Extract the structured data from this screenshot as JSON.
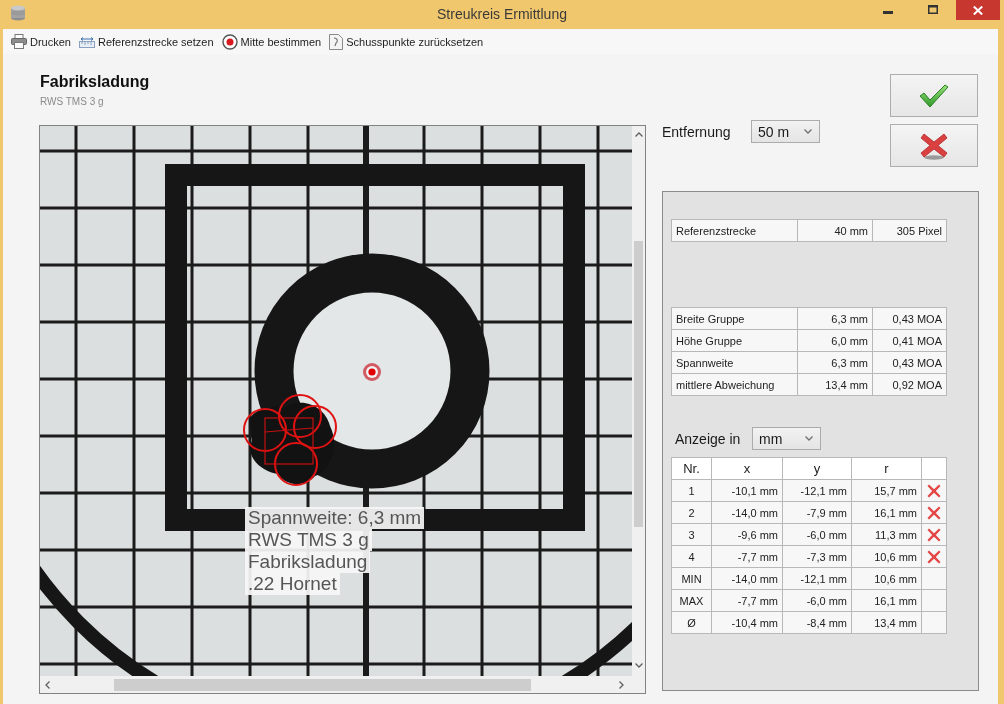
{
  "window": {
    "title": "Streukreis Ermittlung"
  },
  "toolbar": [
    {
      "kind": "print",
      "label": "Drucken"
    },
    {
      "kind": "reference",
      "label": "Referenzstrecke setzen"
    },
    {
      "kind": "center",
      "label": "Mitte bestimmen"
    },
    {
      "kind": "reset",
      "label": "Schusspunkte zurücksetzen"
    }
  ],
  "header": {
    "title": "Fabriksladung",
    "subtitle": "RWS TMS 3 g"
  },
  "target": {
    "caption": [
      "Spannweite: 6,3 mm",
      "RWS TMS 3 g",
      "Fabriksladung",
      ".22 Hornet"
    ]
  },
  "distance": {
    "label": "Entfernung",
    "value": "50 m"
  },
  "reference": {
    "label": "Referenzstrecke",
    "length": "40 mm",
    "pixels": "305 Pixel"
  },
  "group_stats": [
    {
      "label": "Breite Gruppe",
      "mm": "6,3 mm",
      "moa": "0,43 MOA"
    },
    {
      "label": "Höhe Gruppe",
      "mm": "6,0 mm",
      "moa": "0,41 MOA"
    },
    {
      "label": "Spannweite",
      "mm": "6,3 mm",
      "moa": "0,43 MOA"
    },
    {
      "label": "mittlere Abweichung",
      "mm": "13,4 mm",
      "moa": "0,92 MOA"
    }
  ],
  "display_unit": {
    "label": "Anzeige in",
    "value": "mm"
  },
  "shots": {
    "columns": [
      "Nr.",
      "x",
      "y",
      "r"
    ],
    "rows": [
      {
        "kind": "shot",
        "nr": "1",
        "x": "-10,1 mm",
        "y": "-12,1 mm",
        "r": "15,7 mm"
      },
      {
        "kind": "shot",
        "nr": "2",
        "x": "-14,0 mm",
        "y": "-7,9 mm",
        "r": "16,1 mm"
      },
      {
        "kind": "shot",
        "nr": "3",
        "x": "-9,6 mm",
        "y": "-6,0 mm",
        "r": "11,3 mm"
      },
      {
        "kind": "shot",
        "nr": "4",
        "x": "-7,7 mm",
        "y": "-7,3 mm",
        "r": "10,6 mm"
      },
      {
        "kind": "summary",
        "nr": "MIN",
        "x": "-14,0 mm",
        "y": "-12,1 mm",
        "r": "10,6 mm"
      },
      {
        "kind": "summary",
        "nr": "MAX",
        "x": "-7,7 mm",
        "y": "-6,0 mm",
        "r": "16,1 mm"
      },
      {
        "kind": "summary",
        "nr": "Ø",
        "x": "-10,4 mm",
        "y": "-8,4 mm",
        "r": "13,4 mm"
      }
    ]
  }
}
